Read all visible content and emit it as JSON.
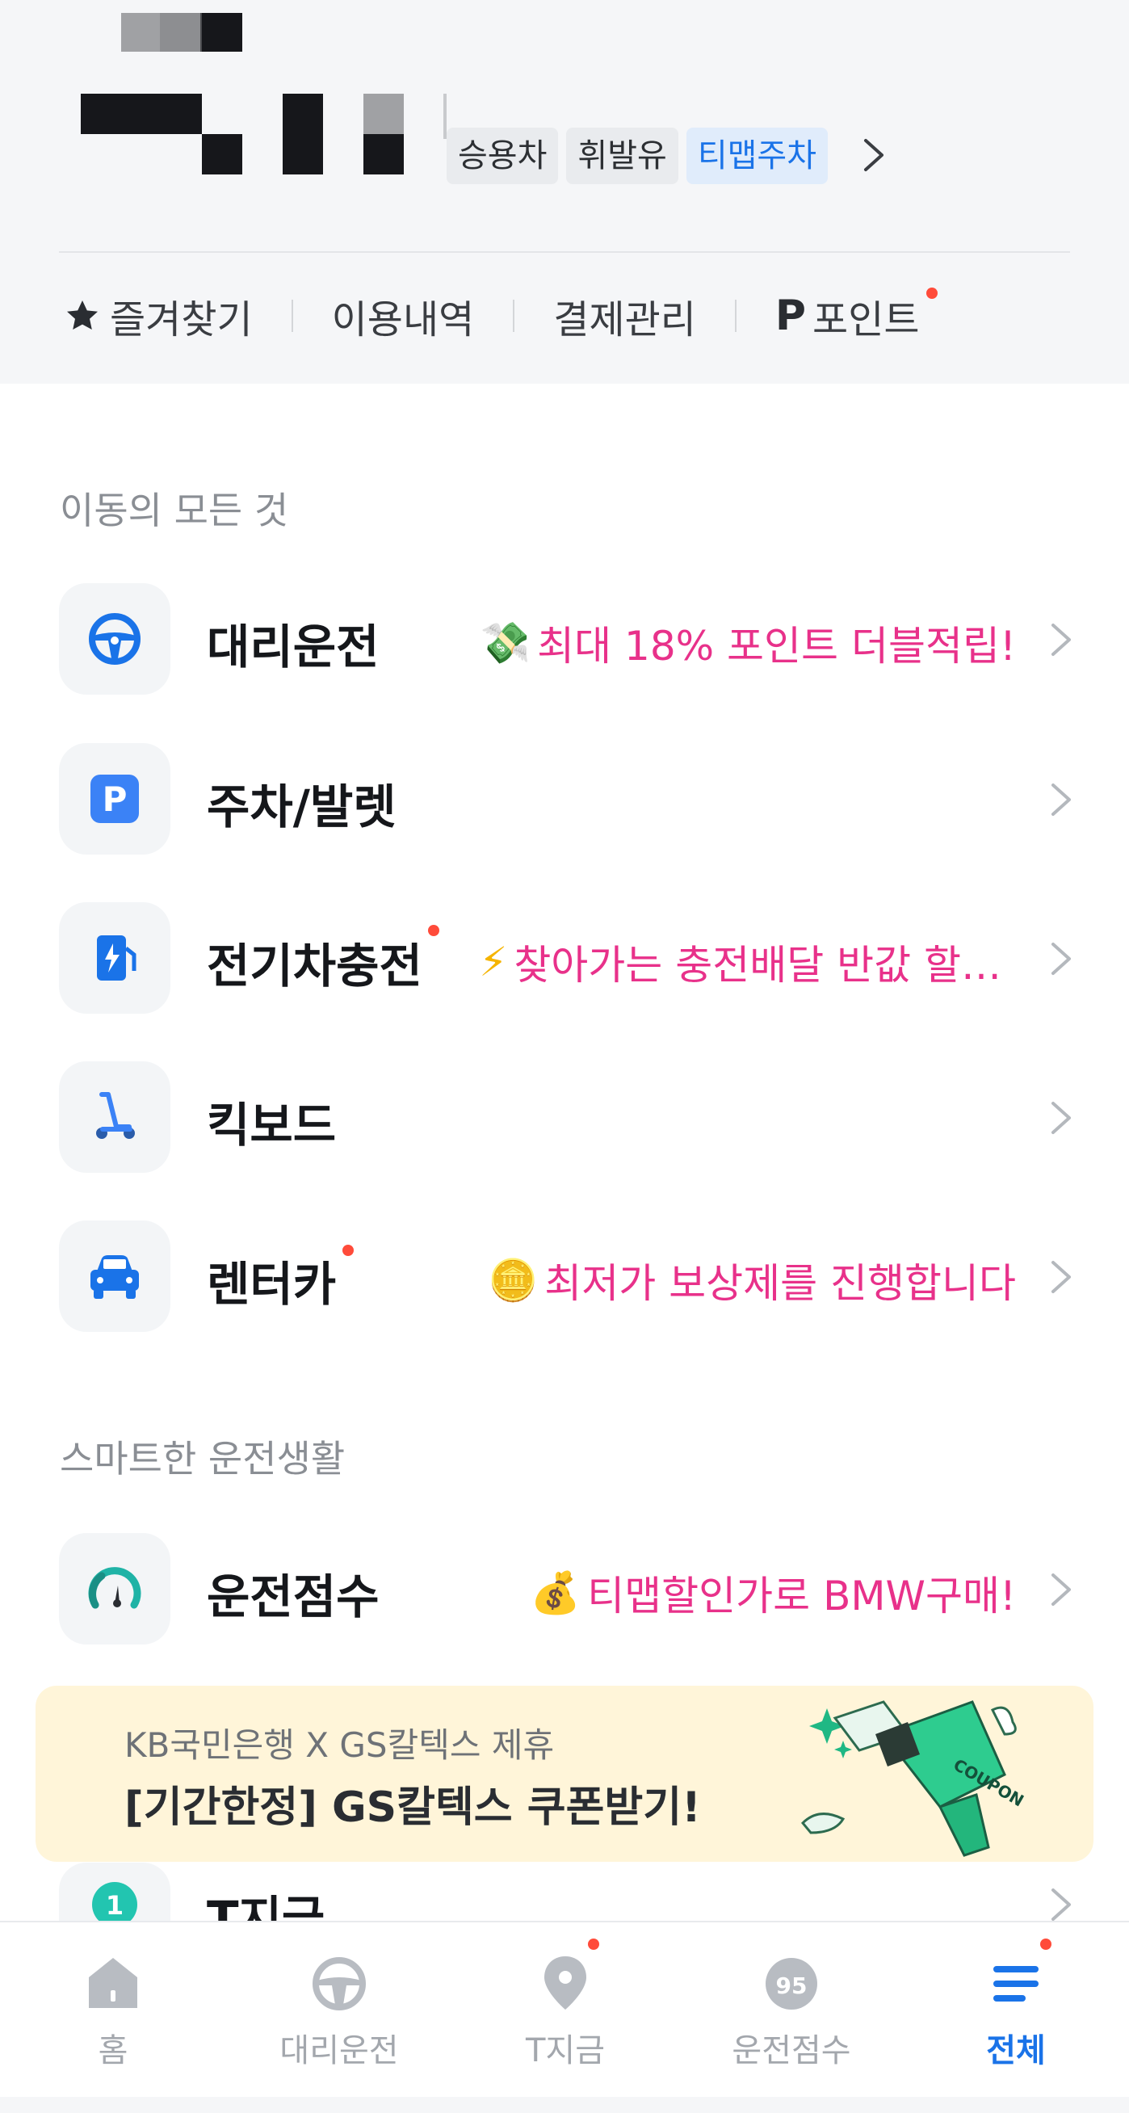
{
  "header": {
    "vehicle_tags": [
      {
        "label": "승용차",
        "active": false
      },
      {
        "label": "휘발유",
        "active": false
      },
      {
        "label": "티맵주차",
        "active": true
      }
    ],
    "quick_menu": [
      {
        "label": "즐겨찾기",
        "icon": "star-icon"
      },
      {
        "label": "이용내역"
      },
      {
        "label": "결제관리"
      },
      {
        "label": "포인트",
        "prefix": "P",
        "has_badge": true
      }
    ]
  },
  "sections": {
    "mobility_title": "이동의 모든 것",
    "smart_title": "스마트한 운전생활"
  },
  "mobility_items": [
    {
      "title": "대리운전",
      "icon": "steering-wheel-icon",
      "promo_emoji": "💸",
      "promo": "최대 18% 포인트 더블적립!"
    },
    {
      "title": "주차/발렛",
      "icon": "parking-icon",
      "promo": ""
    },
    {
      "title": "전기차충전",
      "icon": "ev-charger-icon",
      "badge": true,
      "promo_emoji": "⚡",
      "promo": "찾아가는 충전배달 반값 할…"
    },
    {
      "title": "킥보드",
      "icon": "kickboard-icon",
      "promo": ""
    },
    {
      "title": "렌터카",
      "icon": "car-icon",
      "badge": true,
      "promo_emoji": "🪙",
      "promo": "최저가 보상제를 진행합니다"
    }
  ],
  "smart_items": [
    {
      "title": "운전점수",
      "icon": "speedometer-icon",
      "promo_emoji": "💰",
      "promo": "티맵할인가로 BMW구매!"
    }
  ],
  "banner": {
    "subtitle": "KB국민은행 X GS칼텍스 제휴",
    "title": "[기간한정] GS칼텍스 쿠폰받기!",
    "art_text": "COUPON"
  },
  "partial_item": {
    "title": "T지금",
    "icon_number": "1"
  },
  "tabbar": [
    {
      "label": "홈",
      "icon": "home-icon"
    },
    {
      "label": "대리운전",
      "icon": "steering-wheel-icon"
    },
    {
      "label": "T지금",
      "icon": "location-pin-icon",
      "badge": true
    },
    {
      "label": "운전점수",
      "icon": "score-gauge-icon",
      "value": "95"
    },
    {
      "label": "전체",
      "icon": "menu-icon",
      "badge": true,
      "active": true
    }
  ],
  "colors": {
    "accent": "#1a73e8",
    "promo": "#e8318a",
    "badge": "#ff4b3a",
    "banner_bg": "#fff5d9"
  }
}
